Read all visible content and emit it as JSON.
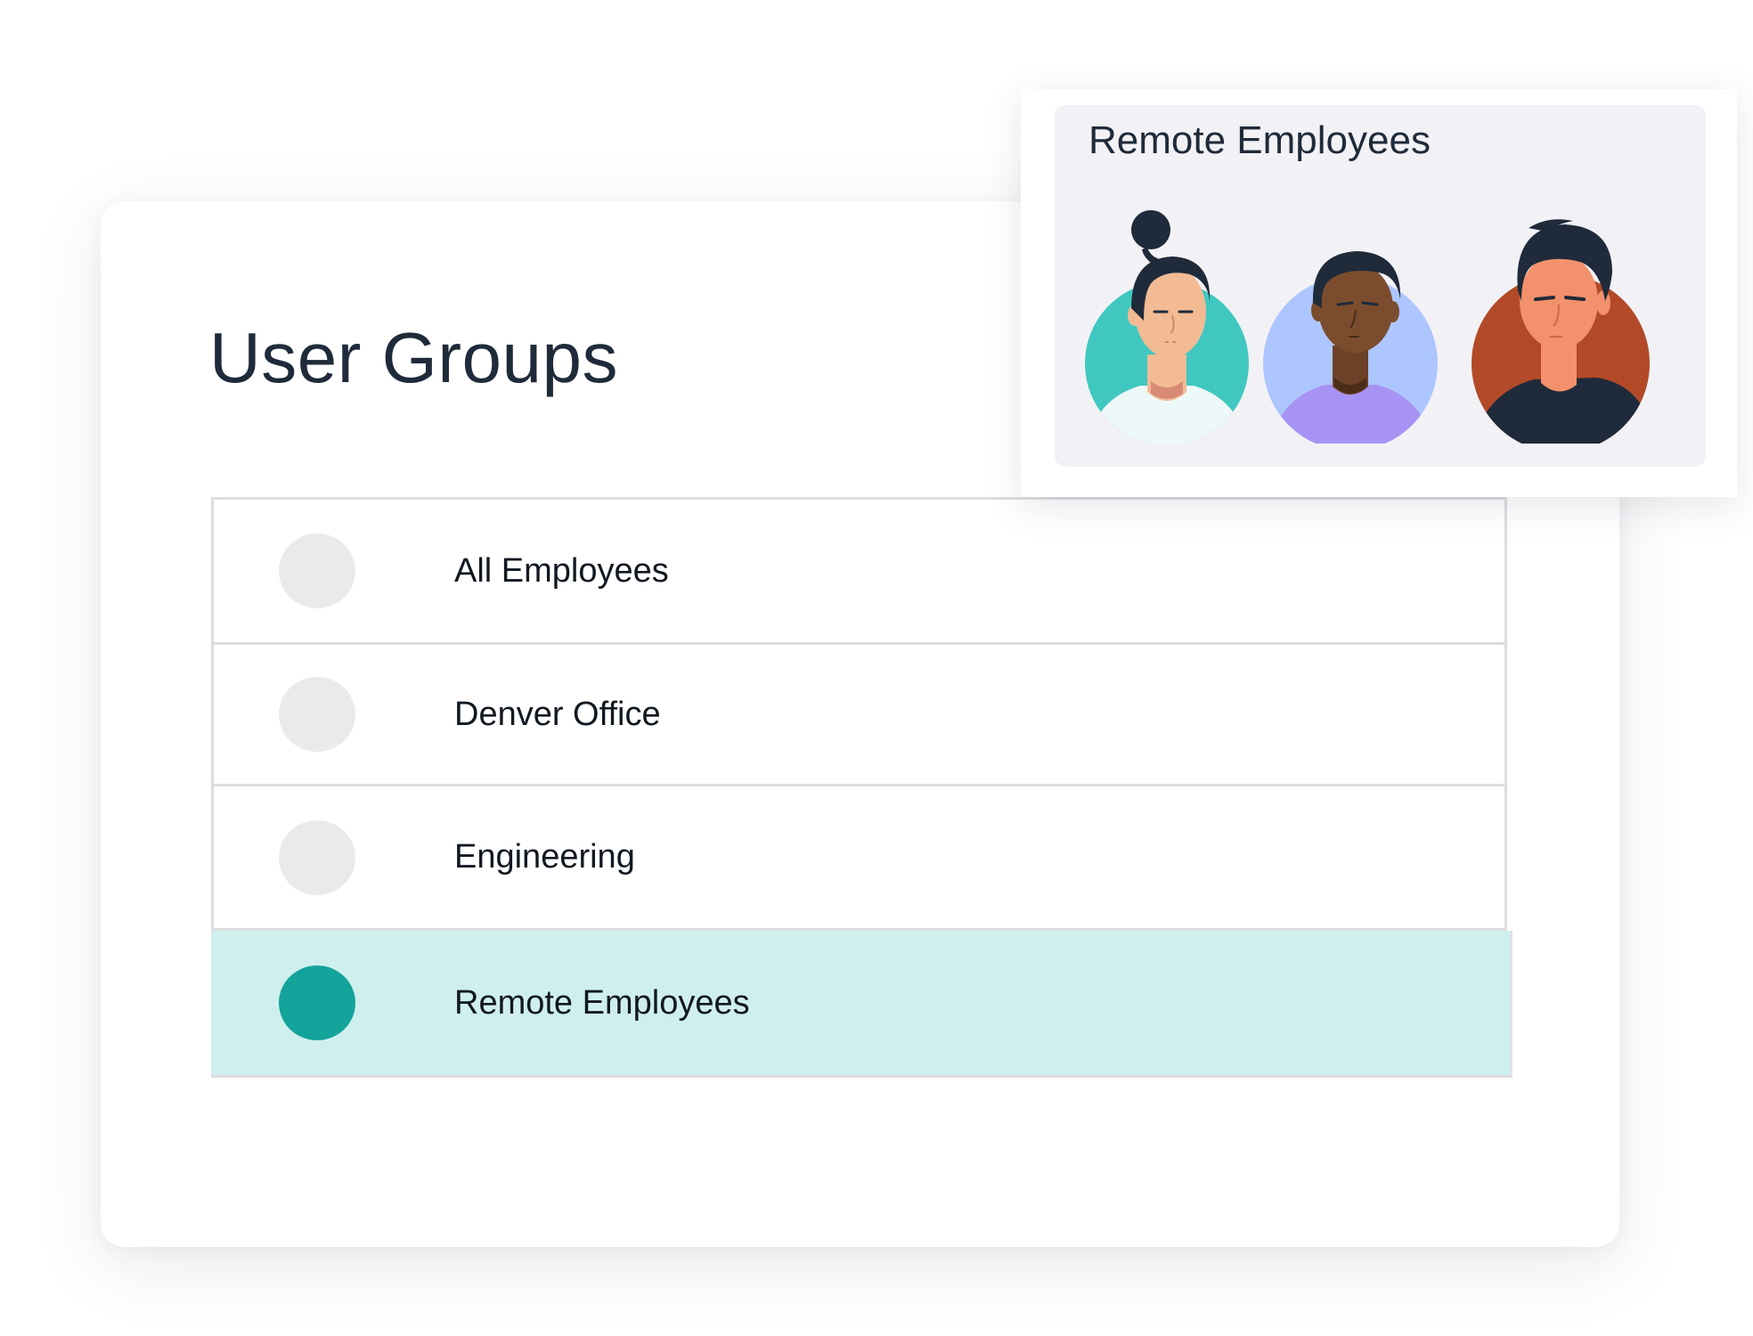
{
  "page": {
    "title": "User Groups"
  },
  "groups": [
    {
      "label": "All Employees",
      "selected": false
    },
    {
      "label": "Denver Office",
      "selected": false
    },
    {
      "label": "Engineering",
      "selected": false
    },
    {
      "label": "Remote Employees",
      "selected": true
    }
  ],
  "popover": {
    "title": "Remote Employees",
    "avatars": [
      {
        "icon": "woman-hair-bun-avatar-icon",
        "background": "#40c8c0"
      },
      {
        "icon": "man-dark-skin-avatar-icon",
        "background": "#aec6ff"
      },
      {
        "icon": "man-black-hair-avatar-icon",
        "background": "#b24a28"
      }
    ]
  },
  "colors": {
    "accent": "#14a39b",
    "selected_row": "#cfefee",
    "radio_unselected": "#e9eaec",
    "title_text": "#1f2a3a"
  }
}
